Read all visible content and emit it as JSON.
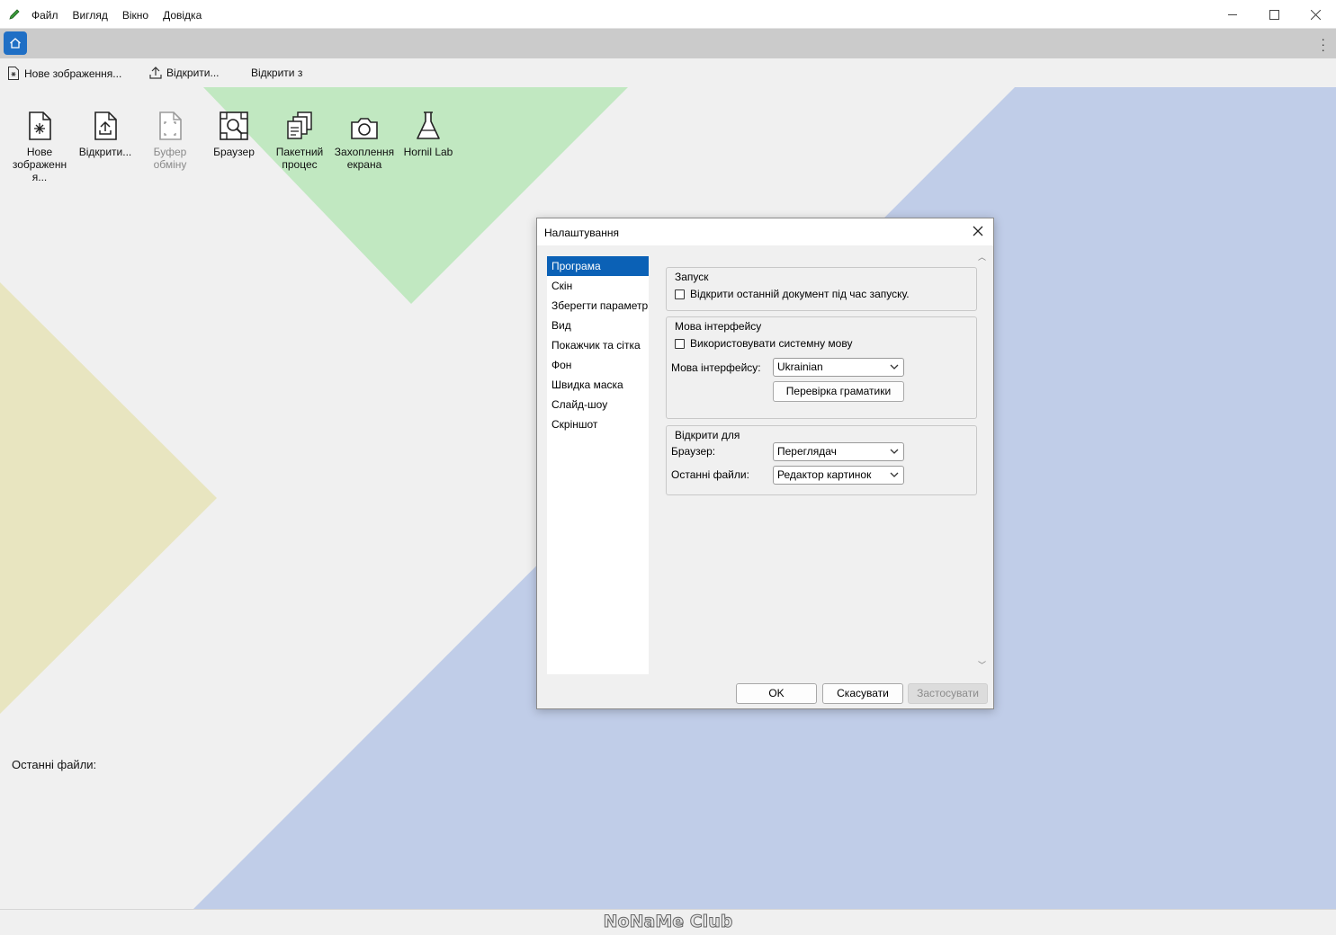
{
  "menu": [
    "Файл",
    "Вигляд",
    "Вікно",
    "Довідка"
  ],
  "toolbar": {
    "new_image": "Нове зображення...",
    "open": "Відкрити...",
    "open_from": "Відкрити з"
  },
  "launcher": [
    {
      "label": "Нове зображенн я...",
      "icon": "new-image-icon",
      "enabled": true
    },
    {
      "label": "Відкрити...",
      "icon": "open-file-icon",
      "enabled": true
    },
    {
      "label": "Буфер обміну",
      "icon": "clipboard-icon",
      "enabled": false
    },
    {
      "label": "Браузер",
      "icon": "browser-icon",
      "enabled": true
    },
    {
      "label": "Пакетний процес",
      "icon": "batch-icon",
      "enabled": true
    },
    {
      "label": "Захоплення екрана",
      "icon": "camera-icon",
      "enabled": true
    },
    {
      "label": "Hornil Lab",
      "icon": "flask-icon",
      "enabled": true
    }
  ],
  "recent_files_label": "Останні файли:",
  "watermark": "NoNaMe Club",
  "colors": {
    "accent": "#0b61b6",
    "home_button": "#1f6fc5",
    "bg_green": "#c1e8c1",
    "bg_blue": "#c0cde8",
    "bg_yellow": "#e8e5c0"
  },
  "dialog": {
    "title": "Налаштування",
    "nav": [
      "Програма",
      "Скін",
      "Зберегти параметри",
      "Вид",
      "Покажчик та сітка",
      "Фон",
      "Швидка маска",
      "Слайд-шоу",
      "Скріншот"
    ],
    "startup": {
      "title": "Запуск",
      "open_last": "Відкрити останній документ під час запуску."
    },
    "language": {
      "title": "Мова інтерфейсу",
      "use_system": "Використовувати системну мову",
      "label": "Мова інтерфейсу:",
      "value": "Ukrainian",
      "grammar_button": "Перевірка граматики"
    },
    "open_for": {
      "title": "Відкрити для",
      "browser_label": "Браузер:",
      "browser_value": "Переглядач",
      "recent_label": "Останні файли:",
      "recent_value": "Редактор картинок"
    },
    "buttons": {
      "ok": "OK",
      "cancel": "Скасувати",
      "apply": "Застосувати"
    }
  }
}
